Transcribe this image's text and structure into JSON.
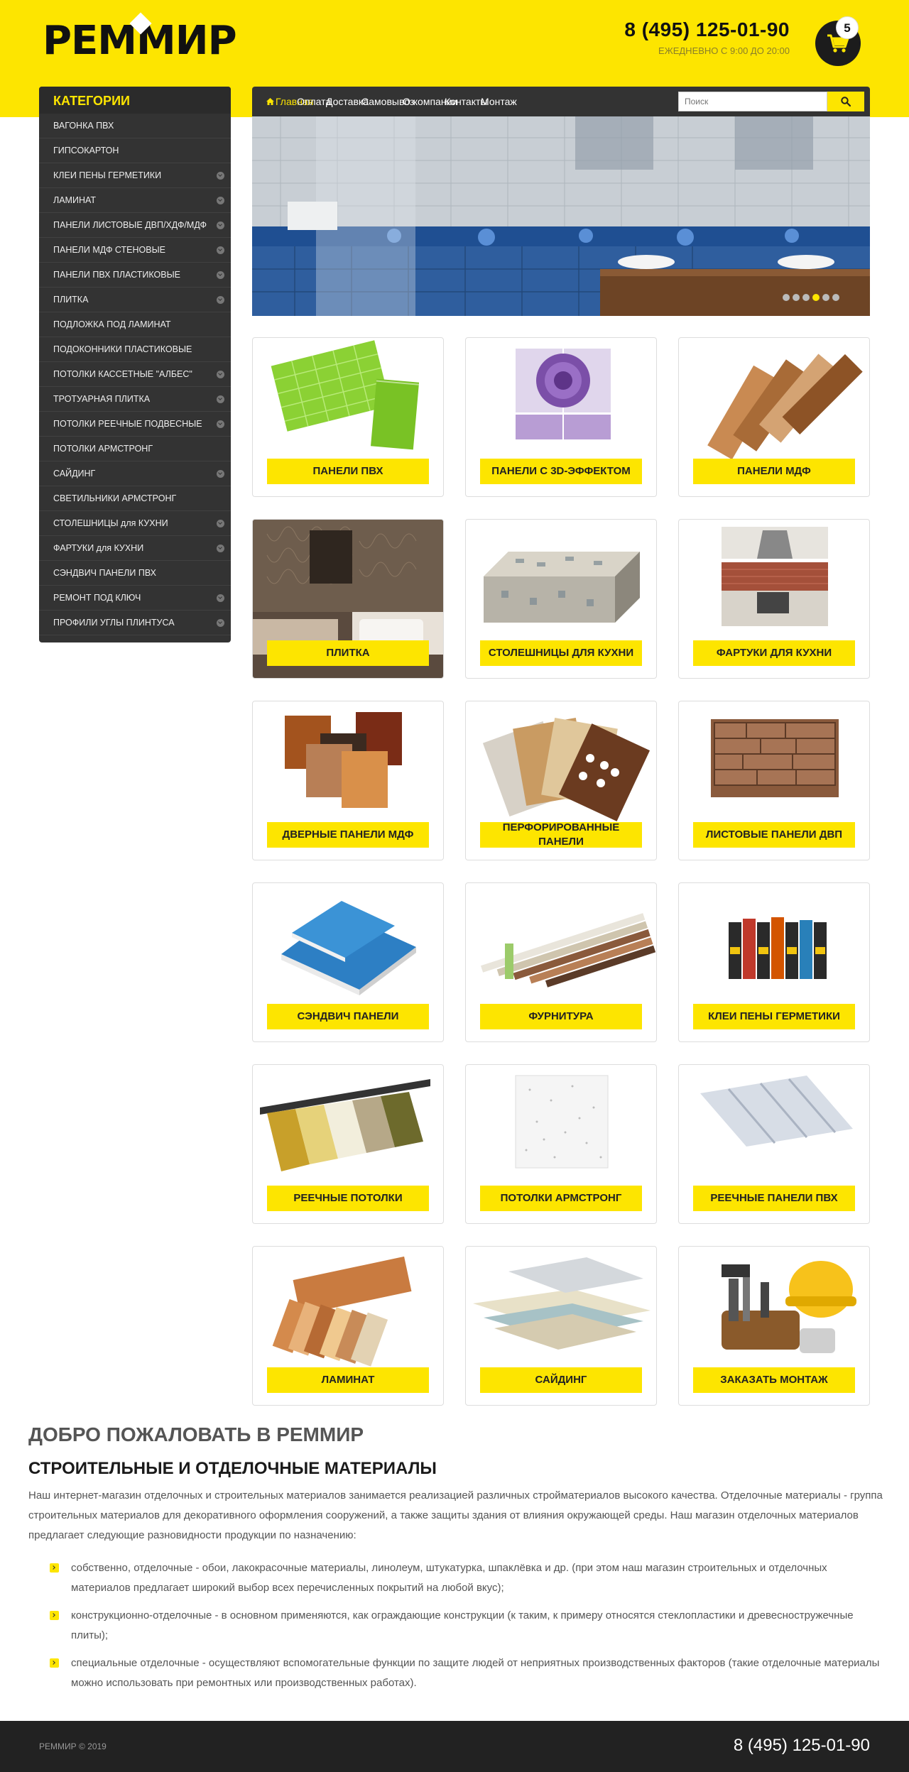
{
  "header": {
    "logo": "РЕММИР",
    "phone": "8 (495) 125-01-90",
    "hours": "ЕЖЕДНЕВНО С 9:00 ДО 20:00",
    "cart_count": "5",
    "cart_icon": "shopping-cart-icon",
    "accent_color": "#fde500"
  },
  "sidebar": {
    "title": "КАТЕГОРИИ",
    "items": [
      {
        "label": "ВАГОНКА ПВХ",
        "has_children": false
      },
      {
        "label": "ГИПСОКАРТОН",
        "has_children": false
      },
      {
        "label": "КЛЕИ ПЕНЫ ГЕРМЕТИКИ",
        "has_children": true
      },
      {
        "label": "ЛАМИНАТ",
        "has_children": true
      },
      {
        "label": "ПАНЕЛИ ЛИСТОВЫЕ ДВП/ХДФ/МДФ",
        "has_children": true
      },
      {
        "label": "ПАНЕЛИ МДФ СТЕНОВЫЕ",
        "has_children": true
      },
      {
        "label": "ПАНЕЛИ ПВХ ПЛАСТИКОВЫЕ",
        "has_children": true
      },
      {
        "label": "ПЛИТКА",
        "has_children": true
      },
      {
        "label": "ПОДЛОЖКА ПОД ЛАМИНАТ",
        "has_children": false
      },
      {
        "label": "ПОДОКОННИКИ ПЛАСТИКОВЫЕ",
        "has_children": false
      },
      {
        "label": "ПОТОЛКИ КАССЕТНЫЕ \"АЛБЕС\"",
        "has_children": true
      },
      {
        "label": "ТРОТУАРНАЯ ПЛИТКА",
        "has_children": true
      },
      {
        "label": "ПОТОЛКИ РЕЕЧНЫЕ ПОДВЕСНЫЕ",
        "has_children": true
      },
      {
        "label": "ПОТОЛКИ АРМСТРОНГ",
        "has_children": false
      },
      {
        "label": "САЙДИНГ",
        "has_children": true
      },
      {
        "label": "СВЕТИЛЬНИКИ АРМСТРОНГ",
        "has_children": false
      },
      {
        "label": "СТОЛЕШНИЦЫ для КУХНИ",
        "has_children": true
      },
      {
        "label": "ФАРТУКИ для КУХНИ",
        "has_children": true
      },
      {
        "label": "СЭНДВИЧ ПАНЕЛИ ПВХ",
        "has_children": false
      },
      {
        "label": "РЕМОНТ ПОД КЛЮЧ",
        "has_children": true
      },
      {
        "label": "ПРОФИЛИ УГЛЫ ПЛИНТУСА",
        "has_children": true
      }
    ]
  },
  "nav": {
    "items": [
      {
        "label": "Главная",
        "active": true
      },
      {
        "label": "Оплата",
        "active": false
      },
      {
        "label": "Доставка",
        "active": false
      },
      {
        "label": "Самовывоз",
        "active": false
      },
      {
        "label": "О компании",
        "active": false
      },
      {
        "label": "Контакты",
        "active": false
      },
      {
        "label": "Монтаж",
        "active": false
      }
    ],
    "search_placeholder": "Поиск"
  },
  "slider": {
    "slide_count": 6,
    "active_slide": 4
  },
  "products": [
    {
      "label": "ПАНЕЛИ ПВХ",
      "image": "pvc-panels"
    },
    {
      "label": "ПАНЕЛИ С 3D-ЭФФЕКТОМ",
      "image": "3d-panels"
    },
    {
      "label": "ПАНЕЛИ МДФ",
      "image": "mdf-panels"
    },
    {
      "label": "ПЛИТКА",
      "image": "tile"
    },
    {
      "label": "СТОЛЕШНИЦЫ ДЛЯ КУХНИ",
      "image": "countertops"
    },
    {
      "label": "ФАРТУКИ ДЛЯ КУХНИ",
      "image": "backsplash"
    },
    {
      "label": "ДВЕРНЫЕ ПАНЕЛИ МДФ",
      "image": "door-panels"
    },
    {
      "label": "ПЕРФОРИРОВАННЫЕ ПАНЕЛИ",
      "image": "perforated-panels"
    },
    {
      "label": "ЛИСТОВЫЕ ПАНЕЛИ ДВП",
      "image": "sheet-panels"
    },
    {
      "label": "СЭНДВИЧ ПАНЕЛИ",
      "image": "sandwich-panels"
    },
    {
      "label": "ФУРНИТУРА",
      "image": "profiles"
    },
    {
      "label": "КЛЕИ ПЕНЫ ГЕРМЕТИКИ",
      "image": "sealants"
    },
    {
      "label": "РЕЕЧНЫЕ ПОТОЛКИ",
      "image": "slatted-ceiling"
    },
    {
      "label": "ПОТОЛКИ АРМСТРОНГ",
      "image": "armstrong-tile"
    },
    {
      "label": "РЕЕЧНЫЕ ПАНЕЛИ ПВХ",
      "image": "pvc-slats"
    },
    {
      "label": "ЛАМИНАТ",
      "image": "laminate"
    },
    {
      "label": "САЙДИНГ",
      "image": "siding"
    },
    {
      "label": "ЗАКАЗАТЬ МОНТАЖ",
      "image": "tools-helmet"
    }
  ],
  "about": {
    "title": "ДОБРО ПОЖАЛОВАТЬ В РЕММИР",
    "subtitle": "СТРОИТЕЛЬНЫЕ И ОТДЕЛОЧНЫЕ МАТЕРИАЛЫ",
    "intro": "Наш интернет-магазин отделочных и строительных материалов занимается реализацией различных стройматериалов высокого качества. Отделочные материалы - группа строительных материалов для декоративного оформления сооружений, а также защиты здания от влияния окружающей среды. Наш магазин отделочных материалов предлагает следующие разновидности продукции по назначению:",
    "bullets": [
      "собственно, отделочные - обои, лакокрасочные материалы, линолеум, штукатурка, шпаклёвка и др. (при этом наш магазин строительных и отделочных материалов предлагает широкий выбор всех перечисленных покрытий на любой вкус);",
      "конструкционно-отделочные - в основном применяются, как ограждающие конструкции (к таким, к примеру относятся стеклопластики и древесностружечные плиты);",
      "специальные отделочные - осуществляют вспомогательные функции по защите людей от неприятных производственных факторов (такие отделочные материалы можно использовать при ремонтных или производственных работах)."
    ]
  },
  "footer": {
    "copyright": "РЕММИР © 2019",
    "phone": "8 (495) 125-01-90"
  }
}
